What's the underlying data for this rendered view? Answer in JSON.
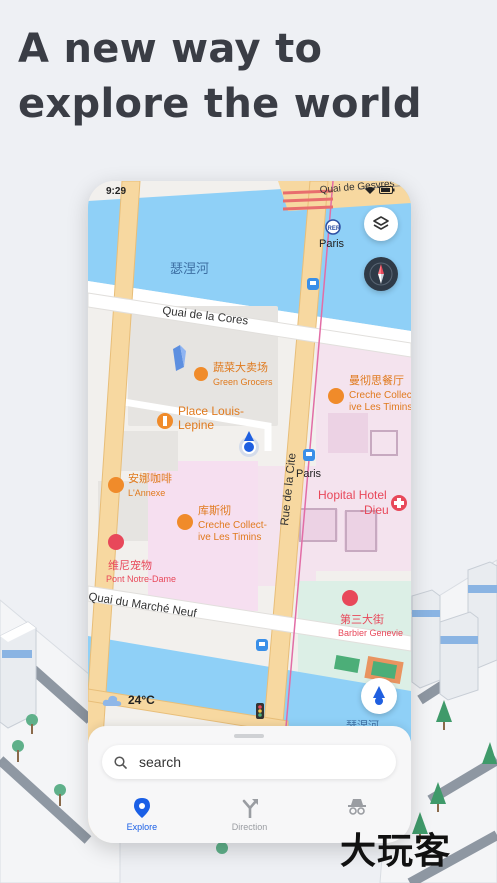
{
  "headline": {
    "line1": "A new way to",
    "line2": "explore the world"
  },
  "status_bar": {
    "time": "9:29"
  },
  "map": {
    "labels": {
      "river_cn": "瑟涅河",
      "river_cn_bottom": "瑟涅河",
      "quai_cores": "Quai de la  Cores",
      "quai_marche": "Quai du Marché Neuf",
      "rue_cite": "Rue de la Cite",
      "quai_gesvres": "Quai de Gesvres",
      "paris_rer": "Paris",
      "paris_bus": "Paris",
      "rer_badge": "RER"
    },
    "pois": {
      "green_grocers_cn": "蔬菜大卖场",
      "green_grocers": "Green Grocers",
      "place_louis_1": "Place Louis-",
      "place_louis_2": "Lepine",
      "annexe_cn": "安娜咖啡",
      "annexe": "L'Annexe",
      "pont_cn": "维尼宠物",
      "pont": "Pont Notre-Dame",
      "creche_center_cn": "库斯彻",
      "creche_center_1": "Creche Collect-",
      "creche_center_2": "ive Les Timins",
      "creche_right_cn": "曼彻思餐厅",
      "creche_right_1": "Creche Collec",
      "creche_right_2": "ive Les Timins",
      "hopital_1": "Hopital Hotel",
      "hopital_2": "-Dieu",
      "barbier_cn": "第三大街",
      "barbier": "Barbier Genevie"
    },
    "colors": {
      "water": "#8fd0f7",
      "road": "#f7d8a0",
      "road_edge": "#e8be79",
      "poi_orange": "#f08b2a",
      "poi_red": "#e8485a",
      "hospital_zone": "#f4e3ee",
      "park": "#dcefe6"
    }
  },
  "weather": {
    "temperature": "24°C",
    "icon": "cloud-icon"
  },
  "search": {
    "placeholder": "search"
  },
  "tabs": [
    {
      "label": "Explore",
      "icon": "location-pin-icon",
      "active": true
    },
    {
      "label": "Direction",
      "icon": "direction-fork-icon",
      "active": false
    },
    {
      "label": "",
      "icon": "incognito-icon",
      "active": false
    }
  ],
  "watermark": "大玩客"
}
